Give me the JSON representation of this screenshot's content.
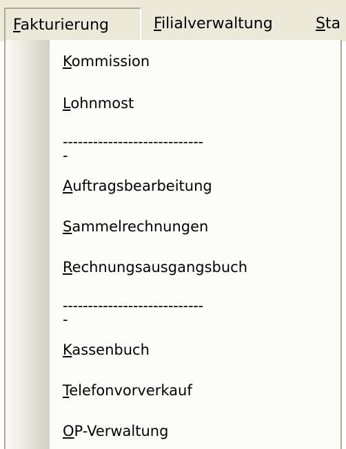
{
  "menubar": {
    "items": [
      {
        "underline": "F",
        "rest": "akturierung"
      },
      {
        "underline": "F",
        "rest": "ilialverwaltung"
      },
      {
        "underline": "S",
        "rest": "ta"
      }
    ]
  },
  "menu": {
    "items": [
      {
        "underline": "K",
        "rest": "ommission"
      },
      {
        "underline": "L",
        "rest": "ohnmost"
      },
      {
        "text": "----------------------------\n-"
      },
      {
        "underline": "A",
        "rest": "uftragsbearbeitung"
      },
      {
        "underline": "S",
        "rest": "ammelrechnungen"
      },
      {
        "underline": "R",
        "rest": "echnungsausgangsbuch"
      },
      {
        "text": "----------------------------\n-"
      },
      {
        "underline": "K",
        "rest": "assenbuch"
      },
      {
        "underline": "T",
        "rest": "elefonvorverkauf"
      },
      {
        "underline": "O",
        "rest": "P-Verwaltung"
      }
    ]
  }
}
